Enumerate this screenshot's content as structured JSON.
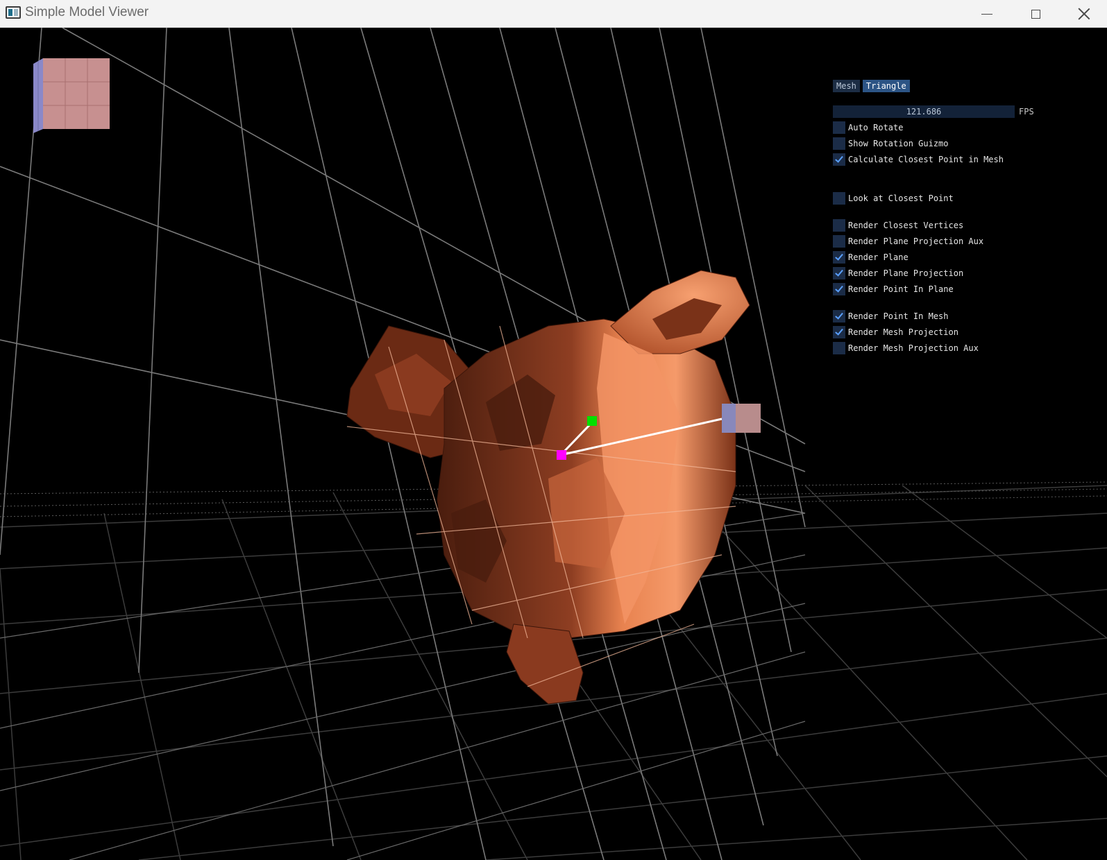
{
  "window": {
    "title": "Simple Model Viewer",
    "icon": "app-window-icon",
    "controls": {
      "minimize": "minimize-icon",
      "maximize": "maximize-icon",
      "close": "close-icon"
    }
  },
  "panel": {
    "tabs": [
      {
        "label": "Mesh",
        "active": false
      },
      {
        "label": "Triangle",
        "active": true
      }
    ],
    "fps_value": "121.686",
    "fps_label": "FPS",
    "options": {
      "auto_rotate": {
        "label": "Auto Rotate",
        "checked": false
      },
      "show_rotation_guizmo": {
        "label": "Show Rotation Guizmo",
        "checked": false
      },
      "calc_closest_point": {
        "label": "Calculate Closest Point in Mesh",
        "checked": true
      },
      "look_at_closest": {
        "label": "Look at Closest Point",
        "checked": false
      },
      "render_closest_vertices": {
        "label": "Render Closest Vertices",
        "checked": false
      },
      "render_plane_projection_aux": {
        "label": "Render Plane Projection Aux",
        "checked": false
      },
      "render_plane": {
        "label": "Render Plane",
        "checked": true
      },
      "render_plane_projection": {
        "label": "Render Plane Projection",
        "checked": true
      },
      "render_point_in_plane": {
        "label": "Render Point In Plane",
        "checked": true
      },
      "render_point_in_mesh": {
        "label": "Render Point In Mesh",
        "checked": true
      },
      "render_mesh_projection": {
        "label": "Render Mesh Projection",
        "checked": true
      },
      "render_mesh_projection_aux": {
        "label": "Render Mesh Projection Aux",
        "checked": false
      }
    }
  },
  "colors": {
    "mesh_light": "#f08a5d",
    "mesh_dark": "#5a2412",
    "point_in_plane": "#00e000",
    "point_in_mesh": "#ff00ff",
    "panel_accent": "#2c5485"
  }
}
